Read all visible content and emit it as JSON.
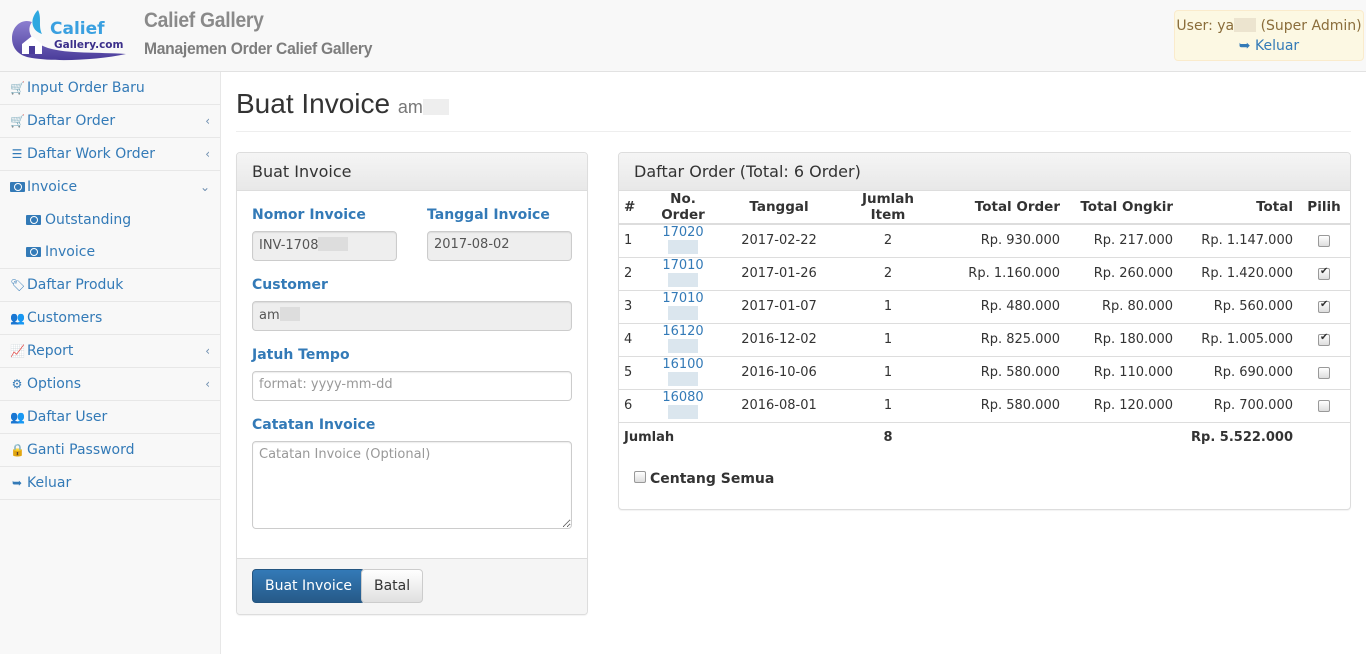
{
  "header": {
    "logo_alt": "Calief Gallery.com",
    "brand_title": "Calief Gallery",
    "brand_subtitle": "Manajemen Order Calief Gallery",
    "user_prefix": "User: ya",
    "user_role": "(Super Admin)",
    "logout_label": "Keluar"
  },
  "sidebar": {
    "items": [
      {
        "label": "Input Order Baru",
        "icon": "cart-plus-icon",
        "chevron": ""
      },
      {
        "label": "Daftar Order",
        "icon": "cart-icon",
        "chevron": "‹"
      },
      {
        "label": "Daftar Work Order",
        "icon": "list-icon",
        "chevron": "‹"
      },
      {
        "label": "Invoice",
        "icon": "money-icon",
        "chevron": "⌄"
      },
      {
        "label": "Daftar Produk",
        "icon": "tags-icon",
        "chevron": ""
      },
      {
        "label": "Customers",
        "icon": "users-icon",
        "chevron": ""
      },
      {
        "label": "Report",
        "icon": "line-chart-icon",
        "chevron": "‹"
      },
      {
        "label": "Options",
        "icon": "cogs-icon",
        "chevron": "‹"
      },
      {
        "label": "Daftar User",
        "icon": "users-icon",
        "chevron": ""
      },
      {
        "label": "Ganti Password",
        "icon": "lock-icon",
        "chevron": ""
      },
      {
        "label": "Keluar",
        "icon": "sign-out-icon",
        "chevron": ""
      }
    ],
    "invoice_sub": [
      {
        "label": "Outstanding",
        "icon": "money-icon"
      },
      {
        "label": "Invoice",
        "icon": "money-icon"
      }
    ]
  },
  "page": {
    "title": "Buat Invoice",
    "subtitle": "am"
  },
  "form": {
    "heading": "Buat Invoice",
    "nomor_invoice_label": "Nomor Invoice",
    "nomor_invoice_value": "INV-1708",
    "tanggal_invoice_label": "Tanggal Invoice",
    "tanggal_invoice_value": "2017-08-02",
    "customer_label": "Customer",
    "customer_value": "am",
    "jatuh_tempo_label": "Jatuh Tempo",
    "jatuh_tempo_placeholder": "format: yyyy-mm-dd",
    "catatan_label": "Catatan Invoice",
    "catatan_placeholder": "Catatan Invoice (Optional)",
    "submit_label": "Buat Invoice",
    "cancel_label": "Batal"
  },
  "orders": {
    "heading": "Daftar Order (Total: 6 Order)",
    "columns": [
      "#",
      "No. Order",
      "Tanggal",
      "Jumlah Item",
      "Total Order",
      "Total Ongkir",
      "Total",
      "Pilih"
    ],
    "rows": [
      {
        "no": "1",
        "order": "17020",
        "tanggal": "2017-02-22",
        "items": "2",
        "total_order": "Rp. 930.000",
        "ongkir": "Rp. 217.000",
        "total": "Rp. 1.147.000",
        "checked": false
      },
      {
        "no": "2",
        "order": "17010",
        "tanggal": "2017-01-26",
        "items": "2",
        "total_order": "Rp. 1.160.000",
        "ongkir": "Rp. 260.000",
        "total": "Rp. 1.420.000",
        "checked": true
      },
      {
        "no": "3",
        "order": "17010",
        "tanggal": "2017-01-07",
        "items": "1",
        "total_order": "Rp. 480.000",
        "ongkir": "Rp. 80.000",
        "total": "Rp. 560.000",
        "checked": true
      },
      {
        "no": "4",
        "order": "16120",
        "tanggal": "2016-12-02",
        "items": "1",
        "total_order": "Rp. 825.000",
        "ongkir": "Rp. 180.000",
        "total": "Rp. 1.005.000",
        "checked": true
      },
      {
        "no": "5",
        "order": "16100",
        "tanggal": "2016-10-06",
        "items": "1",
        "total_order": "Rp. 580.000",
        "ongkir": "Rp. 110.000",
        "total": "Rp. 690.000",
        "checked": false
      },
      {
        "no": "6",
        "order": "16080",
        "tanggal": "2016-08-01",
        "items": "1",
        "total_order": "Rp. 580.000",
        "ongkir": "Rp. 120.000",
        "total": "Rp. 700.000",
        "checked": false
      }
    ],
    "total_label": "Jumlah",
    "total_items": "8",
    "grand_total": "Rp. 5.522.000",
    "check_all_label": "Centang Semua"
  },
  "colors": {
    "link": "#337ab7",
    "primary_button": "#286090",
    "user_box_bg": "#fcf8e3"
  }
}
